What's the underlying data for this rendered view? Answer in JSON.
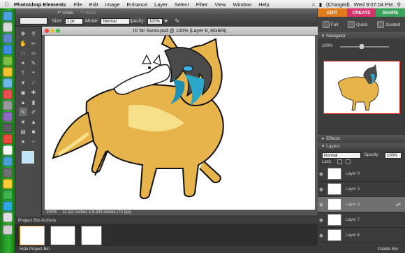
{
  "menubar": {
    "app": "Photoshop Elements",
    "items": [
      "File",
      "Edit",
      "Image",
      "Enhance",
      "Layer",
      "Select",
      "Filter",
      "View",
      "Window",
      "Help"
    ],
    "battery": "(Charged)",
    "clock": "Wed 9:07:04 PM"
  },
  "undo_bar": {
    "undo": "Undo",
    "redo": "Redo"
  },
  "options_bar": {
    "size_label": "Size:",
    "size_value": "1 px",
    "mode_label": "Mode:",
    "mode_value": "Normal",
    "opacity_label": "Opacity:",
    "opacity_value": "100%"
  },
  "document": {
    "title": "ID for Sunni.psd @ 100% (Layer 8, RGB/8)",
    "zoom": "100%",
    "status": "11.111 inches x 8.333 inches (72 ppi)"
  },
  "project_bin": {
    "header": "Project Bin Actions",
    "footer_left": "Hide Project Bin",
    "footer_right": "Palette Bin"
  },
  "modes": {
    "edit": "EDIT",
    "create": "CREATE",
    "share": "SHARE"
  },
  "tasks": {
    "full": "Full",
    "quick": "Quick",
    "guided": "Guided"
  },
  "navigator": {
    "header": "Navigator",
    "zoom": "100%"
  },
  "effects": {
    "header": "Effects"
  },
  "layers": {
    "header": "Layers",
    "blend": "Normal",
    "opacity_label": "Opacity:",
    "opacity_value": "100%",
    "lock_label": "Lock:",
    "items": [
      {
        "name": "Layer 9"
      },
      {
        "name": "Layer 3"
      },
      {
        "name": "Layer 8"
      },
      {
        "name": "Layer 7"
      },
      {
        "name": "Layer 6"
      }
    ]
  },
  "colors": {
    "accent_edit": "#e07a1c",
    "create": "#d6336c",
    "share": "#3aa35b",
    "dock": "#2fb32f"
  }
}
